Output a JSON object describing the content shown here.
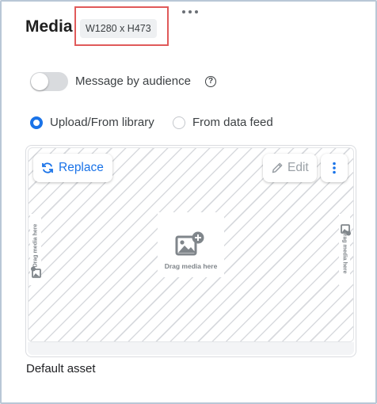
{
  "header": {
    "title": "Media",
    "size_chip": "W1280 x H473",
    "more_icon": "more-horizontal-icon"
  },
  "audience_toggle": {
    "label": "Message by audience",
    "enabled": false
  },
  "source_options": [
    {
      "label": "Upload/From library",
      "selected": true
    },
    {
      "label": "From data feed",
      "selected": false
    }
  ],
  "media_slot": {
    "replace_label": "Replace",
    "edit_label": "Edit",
    "drag_text_center": "Drag media here",
    "drag_text_left": "Drag media here",
    "drag_text_right": "Drag media here"
  },
  "caption": "Default asset",
  "colors": {
    "accent": "#1a73e8",
    "highlight_border": "#e05a5a",
    "frame_border": "#b9c7d6"
  }
}
